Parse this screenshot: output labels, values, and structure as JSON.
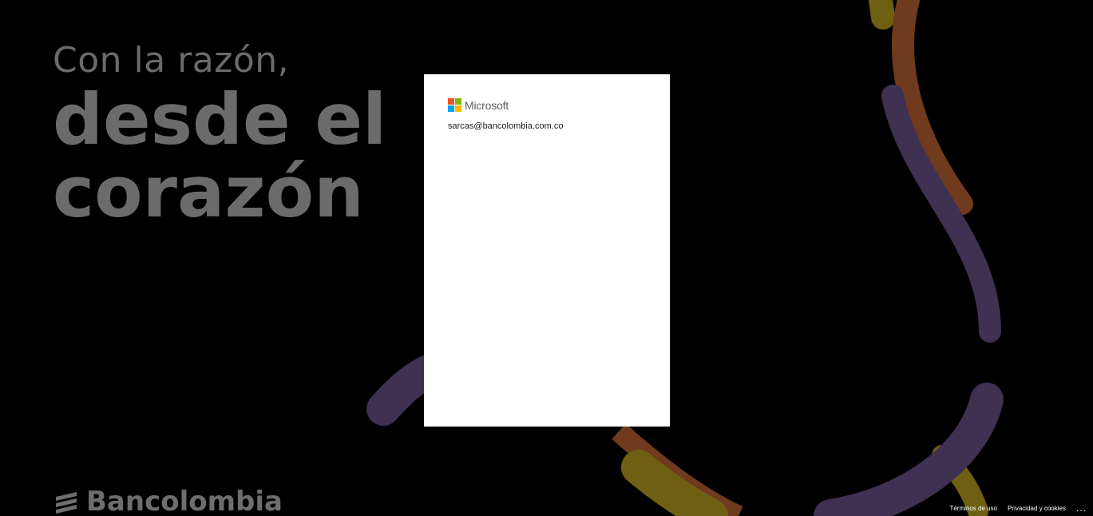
{
  "colors": {
    "background": "#000000",
    "tagline": "#6b6b6b",
    "swoosh_brown": "#6f3a1e",
    "swoosh_purple": "#3e3152",
    "swoosh_olive": "#6e5f12",
    "card": "#ffffff",
    "ms_red": "#f25022",
    "ms_green": "#7fba00",
    "ms_blue": "#00a4ef",
    "ms_yellow": "#ffb900"
  },
  "tagline": {
    "line1": "Con la razón,",
    "line2": "desde el",
    "line3": "corazón"
  },
  "brand": {
    "name": "Bancolombia",
    "icon": "bancolombia-logo-icon"
  },
  "signin_card": {
    "provider": "Microsoft",
    "provider_icon": "microsoft-logo-icon",
    "identity": "sarcas@bancolombia.com.co"
  },
  "footer": {
    "terms": "Términos de uso",
    "privacy": "Privacidad y cookies",
    "more": "...",
    "more_icon": "ellipsis-icon"
  }
}
